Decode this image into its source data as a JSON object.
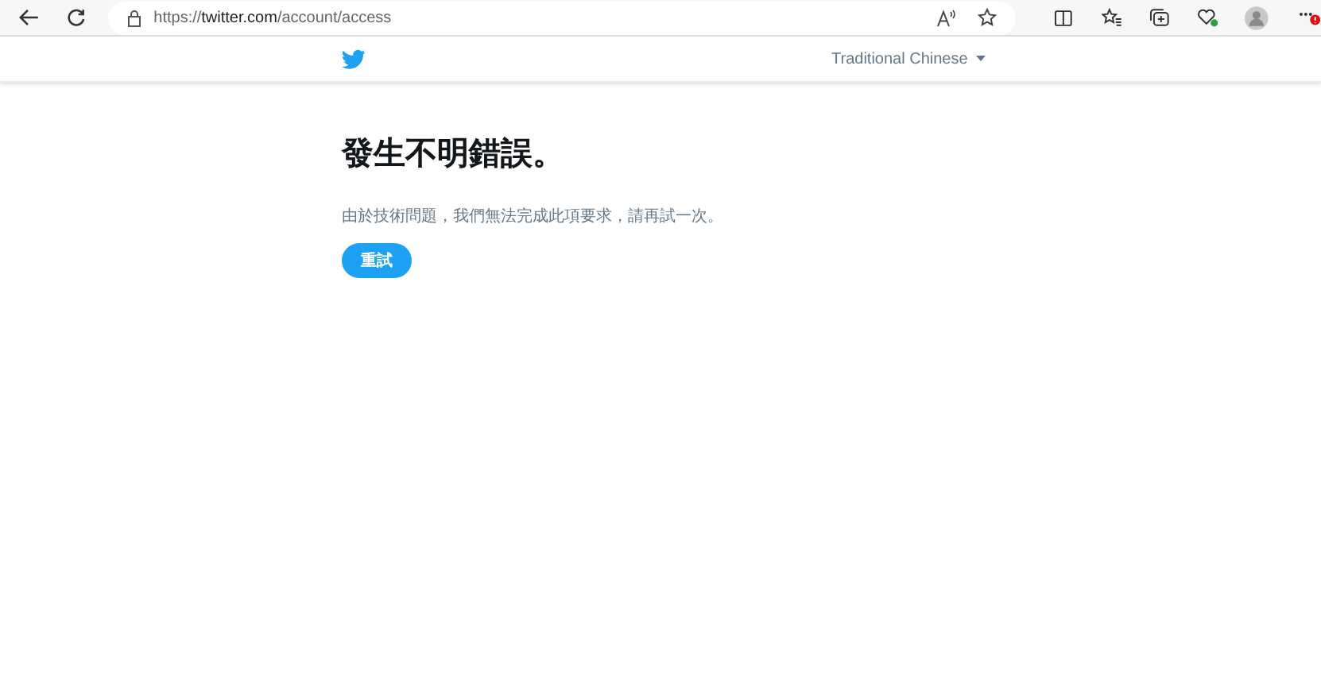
{
  "browser": {
    "url": "https://**twitter.com**/account/access"
  },
  "header": {
    "language": "Traditional Chinese"
  },
  "error": {
    "title": "發生不明錯誤。",
    "message": "由於技術問題，我們無法完成此項要求，請再試一次。",
    "button": "重試"
  }
}
